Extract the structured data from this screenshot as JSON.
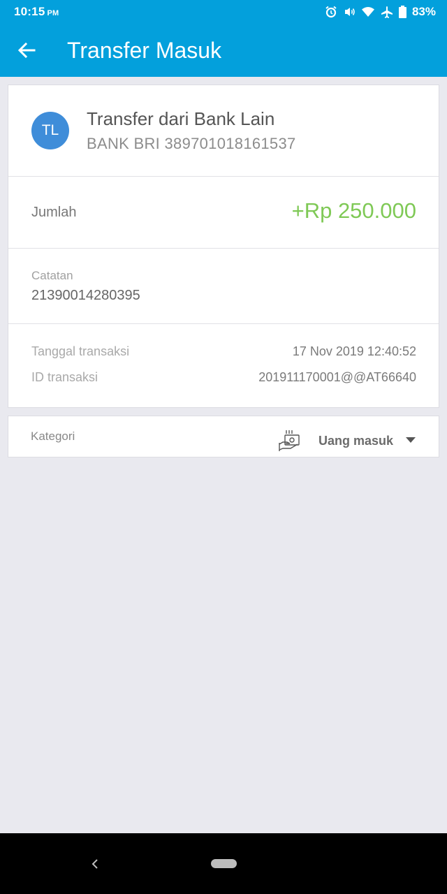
{
  "status_bar": {
    "time": "10:15",
    "ampm": "PM",
    "battery": "83%",
    "icons": [
      "alarm-icon",
      "vibrate-icon",
      "wifi-icon",
      "airplane-icon",
      "battery-icon"
    ]
  },
  "app_bar": {
    "back_icon": "arrow-left-icon",
    "title": "Transfer Masuk"
  },
  "transaction": {
    "avatar_initials": "TL",
    "sender_name": "Transfer dari Bank Lain",
    "sender_account": "BANK BRI 389701018161537",
    "amount_label": "Jumlah",
    "amount_value": "+Rp 250.000",
    "note_label": "Catatan",
    "note_value": "21390014280395",
    "date_label": "Tanggal transaksi",
    "date_value": "17 Nov 2019 12:40:52",
    "id_label": "ID transaksi",
    "id_value": "201911170001@@AT66640"
  },
  "category": {
    "label": "Kategori",
    "icon": "money-hand-icon",
    "value": "Uang masuk"
  },
  "colors": {
    "primary": "#03a0dc",
    "avatar": "#3f8dd9",
    "amount_positive": "#7fc956",
    "background": "#e9e9ef"
  }
}
